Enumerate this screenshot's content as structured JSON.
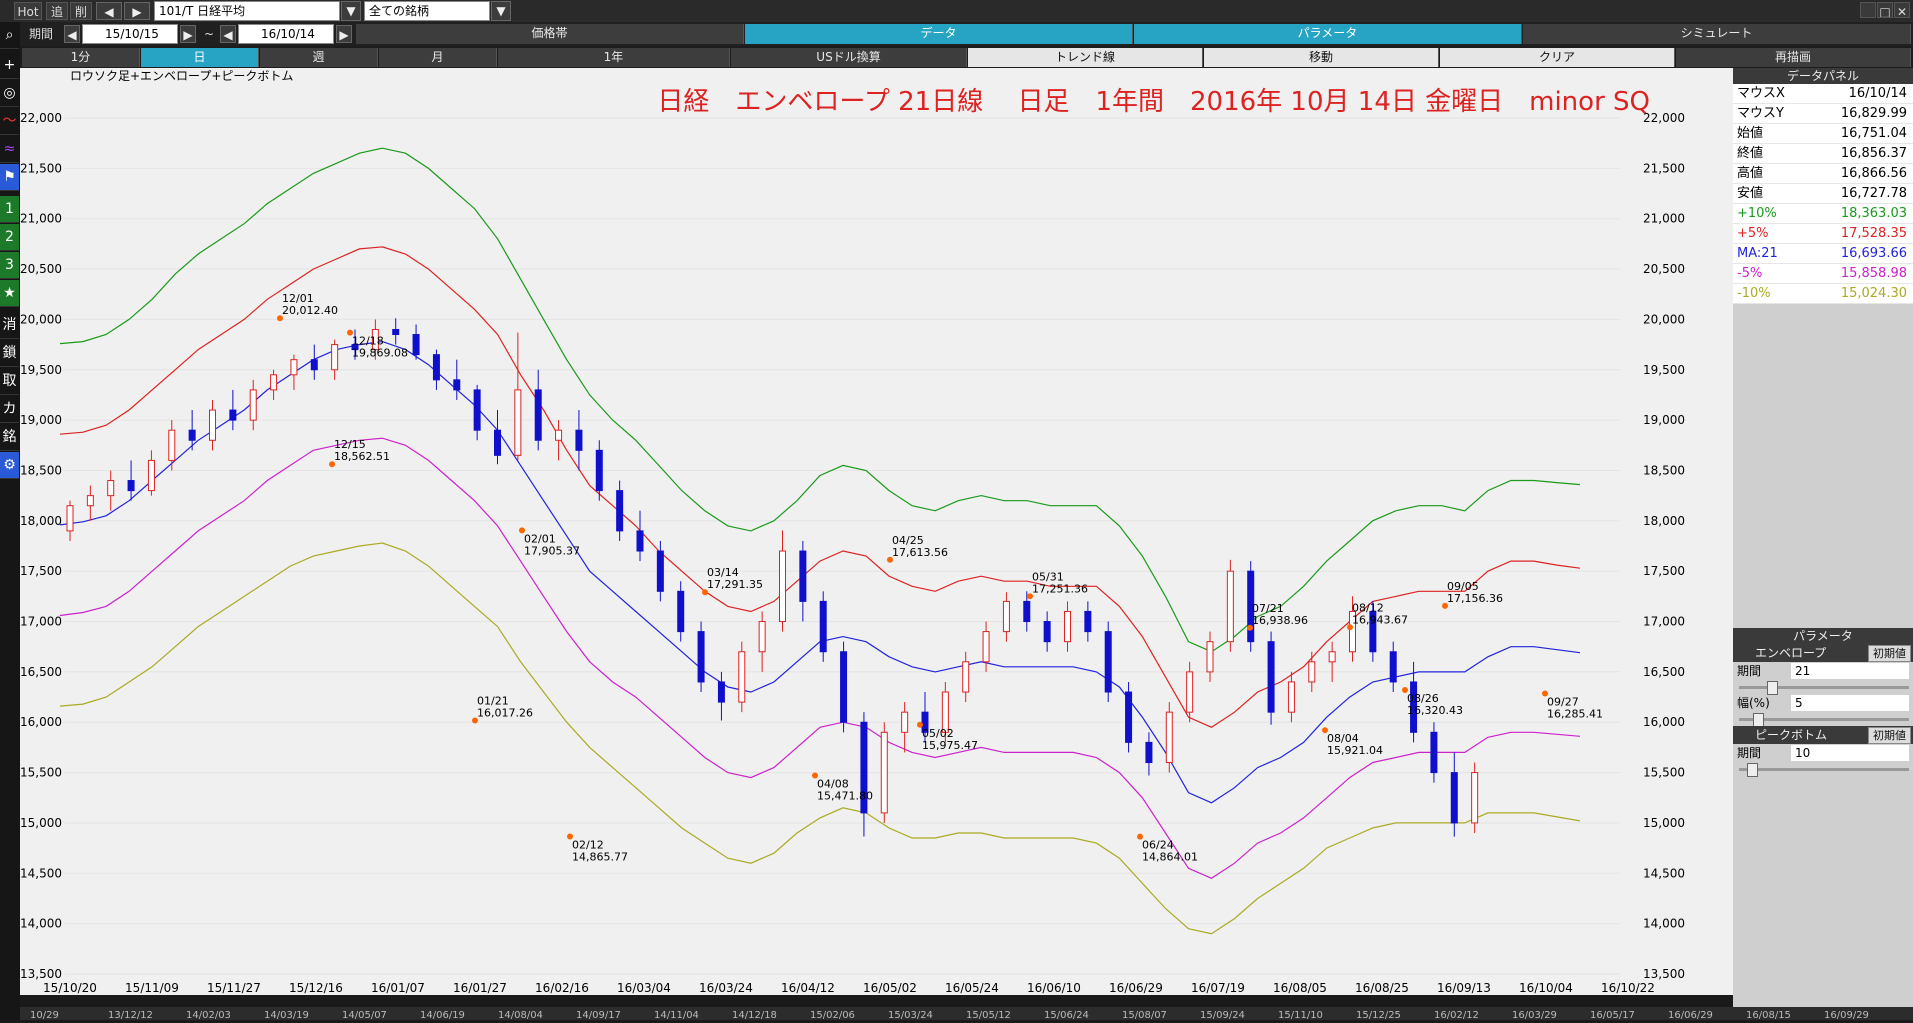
{
  "toolbar": {
    "hot": "Hot",
    "add": "追",
    "del": "削",
    "symbol": "101/T 日経平均",
    "universe": "全ての銘柄"
  },
  "row2": {
    "period_label": "期間",
    "start": "15/10/15",
    "tilde": "~",
    "end": "16/10/14",
    "tabs": [
      "価格帯",
      "データ",
      "パラメータ",
      "シミュレート"
    ]
  },
  "row3": {
    "tabs": [
      "1分",
      "日",
      "週",
      "月",
      "1年",
      "USドル換算",
      "トレンド線",
      "移動",
      "クリア",
      "再描画"
    ]
  },
  "left_tools": [
    "+",
    "◎",
    "〜",
    "≈",
    "⚑",
    "1",
    "2",
    "3",
    "★",
    "消",
    "鎖",
    "取",
    "カ",
    "銘",
    "⚙"
  ],
  "chart_data": {
    "type": "candlestick",
    "indicator_label": "ロウソク足+エンベロープ+ピークボトム",
    "title": "日経　エンベロープ 21日線　 日足　1年間　2016年 10月 14日 金曜日　minor SQ",
    "ylim": [
      13500,
      22000
    ],
    "y_ticks": [
      "22,000",
      "21,500",
      "21,000",
      "20,500",
      "20,000",
      "19,500",
      "19,000",
      "18,500",
      "18,000",
      "17,500",
      "17,000",
      "16,500",
      "16,000",
      "15,500",
      "15,000",
      "14,500",
      "14,000",
      "13,500"
    ],
    "x_ticks": [
      "15/10/20",
      "15/11/09",
      "15/11/27",
      "15/12/16",
      "16/01/07",
      "16/01/27",
      "16/02/16",
      "16/03/04",
      "16/03/24",
      "16/04/12",
      "16/05/02",
      "16/05/24",
      "16/06/10",
      "16/06/29",
      "16/07/19",
      "16/08/05",
      "16/08/25",
      "16/09/13",
      "16/10/04",
      "16/10/22"
    ],
    "bottom_ticks": [
      "10/29",
      "13/12/12",
      "14/02/03",
      "14/03/19",
      "14/05/07",
      "14/06/19",
      "14/08/04",
      "14/09/17",
      "14/11/04",
      "14/12/18",
      "15/02/06",
      "15/03/24",
      "15/05/12",
      "15/06/24",
      "15/08/07",
      "15/09/24",
      "15/11/10",
      "15/12/25",
      "16/02/12",
      "16/03/29",
      "16/05/17",
      "16/06/29",
      "16/08/15",
      "16/09/29"
    ],
    "series": [
      {
        "name": "+10%",
        "color": "#1a9a1a",
        "values": [
          19760,
          19780,
          19850,
          20000,
          20200,
          20450,
          20650,
          20800,
          20950,
          21150,
          21300,
          21450,
          21550,
          21650,
          21700,
          21650,
          21500,
          21300,
          21100,
          20800,
          20400,
          20000,
          19600,
          19250,
          19000,
          18800,
          18550,
          18300,
          18100,
          17950,
          17900,
          18000,
          18200,
          18450,
          18550,
          18500,
          18300,
          18150,
          18100,
          18200,
          18250,
          18200,
          18200,
          18150,
          18150,
          18150,
          17950,
          17650,
          17250,
          16800,
          16700,
          16850,
          17050,
          17150,
          17350,
          17600,
          17800,
          18000,
          18100,
          18150,
          18150,
          18100,
          18300,
          18400,
          18400,
          18380,
          18360
        ]
      },
      {
        "name": "+5%",
        "color": "#dd2222",
        "values": [
          18860,
          18880,
          18950,
          19100,
          19300,
          19500,
          19700,
          19850,
          20000,
          20200,
          20350,
          20500,
          20600,
          20700,
          20720,
          20650,
          20500,
          20300,
          20100,
          19850,
          19450,
          19100,
          18700,
          18350,
          18150,
          17950,
          17700,
          17500,
          17300,
          17150,
          17100,
          17200,
          17400,
          17600,
          17700,
          17650,
          17450,
          17350,
          17300,
          17400,
          17450,
          17400,
          17400,
          17350,
          17350,
          17350,
          17150,
          16850,
          16450,
          16050,
          15950,
          16100,
          16300,
          16400,
          16550,
          16800,
          17000,
          17200,
          17250,
          17300,
          17300,
          17300,
          17500,
          17600,
          17600,
          17560,
          17530
        ]
      },
      {
        "name": "MA:21",
        "color": "#2222dd",
        "values": [
          17960,
          17990,
          18050,
          18200,
          18400,
          18600,
          18800,
          18950,
          19100,
          19300,
          19450,
          19600,
          19700,
          19750,
          19780,
          19700,
          19550,
          19350,
          19150,
          18900,
          18550,
          18200,
          17850,
          17500,
          17300,
          17100,
          16900,
          16700,
          16500,
          16350,
          16300,
          16400,
          16600,
          16800,
          16850,
          16800,
          16650,
          16550,
          16500,
          16550,
          16600,
          16550,
          16550,
          16550,
          16550,
          16500,
          16350,
          16050,
          15700,
          15300,
          15200,
          15350,
          15550,
          15650,
          15800,
          16050,
          16250,
          16400,
          16450,
          16500,
          16500,
          16500,
          16650,
          16750,
          16750,
          16720,
          16690
        ]
      },
      {
        "name": "-5%",
        "color": "#cc22cc",
        "values": [
          17060,
          17090,
          17150,
          17300,
          17500,
          17700,
          17900,
          18050,
          18200,
          18400,
          18550,
          18700,
          18750,
          18800,
          18820,
          18750,
          18600,
          18400,
          18200,
          17950,
          17600,
          17250,
          16900,
          16600,
          16400,
          16250,
          16050,
          15850,
          15650,
          15500,
          15450,
          15550,
          15750,
          15950,
          16000,
          15950,
          15800,
          15700,
          15650,
          15700,
          15750,
          15700,
          15700,
          15700,
          15700,
          15650,
          15500,
          15250,
          14900,
          14550,
          14450,
          14600,
          14800,
          14900,
          15050,
          15250,
          15450,
          15600,
          15650,
          15700,
          15700,
          15700,
          15850,
          15900,
          15900,
          15880,
          15860
        ]
      },
      {
        "name": "-10%",
        "color": "#aaaa22",
        "values": [
          16160,
          16180,
          16250,
          16400,
          16550,
          16750,
          16950,
          17100,
          17250,
          17400,
          17550,
          17650,
          17700,
          17750,
          17780,
          17700,
          17550,
          17350,
          17150,
          16950,
          16600,
          16300,
          16000,
          15750,
          15550,
          15350,
          15150,
          14950,
          14800,
          14650,
          14600,
          14700,
          14900,
          15050,
          15150,
          15100,
          14950,
          14850,
          14850,
          14900,
          14900,
          14850,
          14850,
          14850,
          14850,
          14800,
          14650,
          14400,
          14150,
          13950,
          13900,
          14050,
          14250,
          14400,
          14550,
          14750,
          14850,
          14950,
          15000,
          15000,
          15000,
          15000,
          15100,
          15100,
          15100,
          15060,
          15020
        ]
      }
    ],
    "candles": [
      [
        17900,
        18200,
        17800,
        18150
      ],
      [
        18150,
        18350,
        18000,
        18250
      ],
      [
        18250,
        18500,
        18100,
        18400
      ],
      [
        18400,
        18600,
        18200,
        18300
      ],
      [
        18300,
        18700,
        18250,
        18600
      ],
      [
        18600,
        19000,
        18500,
        18900
      ],
      [
        18900,
        19100,
        18700,
        18800
      ],
      [
        18800,
        19200,
        18700,
        19100
      ],
      [
        19100,
        19300,
        18900,
        19000
      ],
      [
        19000,
        19400,
        18900,
        19300
      ],
      [
        19300,
        19500,
        19200,
        19450
      ],
      [
        19450,
        19650,
        19300,
        19600
      ],
      [
        19600,
        19750,
        19400,
        19500
      ],
      [
        19500,
        19800,
        19400,
        19750
      ],
      [
        19750,
        19900,
        19600,
        19700
      ],
      [
        19700,
        20000,
        19600,
        19900
      ],
      [
        19900,
        20012,
        19750,
        19850
      ],
      [
        19850,
        19950,
        19600,
        19650
      ],
      [
        19650,
        19700,
        19300,
        19400
      ],
      [
        19400,
        19600,
        19200,
        19300
      ],
      [
        19300,
        19350,
        18800,
        18900
      ],
      [
        18900,
        19100,
        18562,
        18650
      ],
      [
        18650,
        19869,
        18600,
        19300
      ],
      [
        19300,
        19500,
        18700,
        18800
      ],
      [
        18800,
        19000,
        18600,
        18900
      ],
      [
        18900,
        19100,
        18500,
        18700
      ],
      [
        18700,
        18800,
        18200,
        18300
      ],
      [
        18300,
        18400,
        17800,
        17900
      ],
      [
        17900,
        18100,
        17600,
        17700
      ],
      [
        17700,
        17800,
        17200,
        17300
      ],
      [
        17300,
        17400,
        16800,
        16900
      ],
      [
        16900,
        17000,
        16300,
        16400
      ],
      [
        16400,
        16500,
        16017,
        16200
      ],
      [
        16200,
        16800,
        16100,
        16700
      ],
      [
        16700,
        17100,
        16500,
        17000
      ],
      [
        17000,
        17905,
        16900,
        17700
      ],
      [
        17700,
        17800,
        17000,
        17200
      ],
      [
        17200,
        17300,
        16600,
        16700
      ],
      [
        16700,
        16800,
        15900,
        16000
      ],
      [
        16000,
        16100,
        14865,
        15100
      ],
      [
        15100,
        16000,
        15000,
        15900
      ],
      [
        15900,
        16200,
        15700,
        16100
      ],
      [
        16100,
        16300,
        15800,
        15900
      ],
      [
        15900,
        16400,
        15800,
        16300
      ],
      [
        16300,
        16700,
        16200,
        16600
      ],
      [
        16600,
        17000,
        16500,
        16900
      ],
      [
        16900,
        17291,
        16800,
        17200
      ],
      [
        17200,
        17300,
        16900,
        17000
      ],
      [
        17000,
        17100,
        16700,
        16800
      ],
      [
        16800,
        17200,
        16700,
        17100
      ],
      [
        17100,
        17200,
        16800,
        16900
      ],
      [
        16900,
        17000,
        16200,
        16300
      ],
      [
        16300,
        16400,
        15700,
        15800
      ],
      [
        15800,
        15900,
        15471,
        15600
      ],
      [
        15600,
        16200,
        15500,
        16100
      ],
      [
        16100,
        16600,
        16000,
        16500
      ],
      [
        16500,
        16900,
        16400,
        16800
      ],
      [
        16800,
        17613,
        16700,
        17500
      ],
      [
        17500,
        17600,
        16700,
        16800
      ],
      [
        16800,
        16900,
        15975,
        16100
      ],
      [
        16100,
        16500,
        16000,
        16400
      ],
      [
        16400,
        16700,
        16300,
        16600
      ],
      [
        16600,
        16800,
        16400,
        16700
      ],
      [
        16700,
        17251,
        16600,
        17100
      ],
      [
        17100,
        17200,
        16600,
        16700
      ],
      [
        16700,
        16800,
        16300,
        16400
      ],
      [
        16400,
        16600,
        15800,
        15900
      ],
      [
        15900,
        16000,
        15400,
        15500
      ],
      [
        15500,
        15700,
        14864,
        15000
      ],
      [
        15000,
        15600,
        14900,
        15500
      ]
    ],
    "peaks": [
      {
        "date": "12/01",
        "value": "20,012.40",
        "y": 20012
      },
      {
        "date": "12/18",
        "value": "19,869.08",
        "y": 19869
      },
      {
        "date": "12/15",
        "value": "18,562.51",
        "y": 18562
      },
      {
        "date": "02/01",
        "value": "17,905.37",
        "y": 17905
      },
      {
        "date": "01/21",
        "value": "16,017.26",
        "y": 16017
      },
      {
        "date": "02/12",
        "value": "14,865.77",
        "y": 14865
      },
      {
        "date": "03/14",
        "value": "17,291.35",
        "y": 17291
      },
      {
        "date": "04/08",
        "value": "15,471.80",
        "y": 15471
      },
      {
        "date": "04/25",
        "value": "17,613.56",
        "y": 17613
      },
      {
        "date": "05/02",
        "value": "15,975.47",
        "y": 15975
      },
      {
        "date": "05/31",
        "value": "17,251.36",
        "y": 17251
      },
      {
        "date": "06/24",
        "value": "14,864.01",
        "y": 14864
      },
      {
        "date": "07/21",
        "value": "16,938.96",
        "y": 16938
      },
      {
        "date": "08/04",
        "value": "15,921.04",
        "y": 15921
      },
      {
        "date": "08/12",
        "value": "16,943.67",
        "y": 16943
      },
      {
        "date": "08/26",
        "value": "16,320.43",
        "y": 16320
      },
      {
        "date": "09/05",
        "value": "17,156.36",
        "y": 17156
      },
      {
        "date": "09/27",
        "value": "16,285.41",
        "y": 16285
      }
    ]
  },
  "data_panel": {
    "title": "データパネル",
    "rows": [
      {
        "k": "マウスX",
        "v": "16/10/14",
        "color": "#000000"
      },
      {
        "k": "マウスY",
        "v": "16,829.99",
        "color": "#000000"
      },
      {
        "k": "始値",
        "v": "16,751.04",
        "color": "#000000"
      },
      {
        "k": "終値",
        "v": "16,856.37",
        "color": "#000000"
      },
      {
        "k": "高値",
        "v": "16,866.56",
        "color": "#000000"
      },
      {
        "k": "安値",
        "v": "16,727.78",
        "color": "#000000"
      },
      {
        "k": "+10%",
        "v": "18,363.03",
        "color": "#1a9a1a"
      },
      {
        "k": "+5%",
        "v": "17,528.35",
        "color": "#dd2222"
      },
      {
        "k": "MA:21",
        "v": "16,693.66",
        "color": "#2222dd"
      },
      {
        "k": "-5%",
        "v": "15,858.98",
        "color": "#cc22cc"
      },
      {
        "k": "-10%",
        "v": "15,024.30",
        "color": "#aaaa22"
      }
    ]
  },
  "param_panel": {
    "title": "パラメータ",
    "envelope": {
      "name": "エンベロープ",
      "init": "初期値",
      "period_label": "期間",
      "period": "21",
      "width_label": "幅(%)",
      "width": "5"
    },
    "peakbottom": {
      "name": "ピークボトム",
      "init": "初期値",
      "period_label": "期間",
      "period": "10"
    }
  }
}
